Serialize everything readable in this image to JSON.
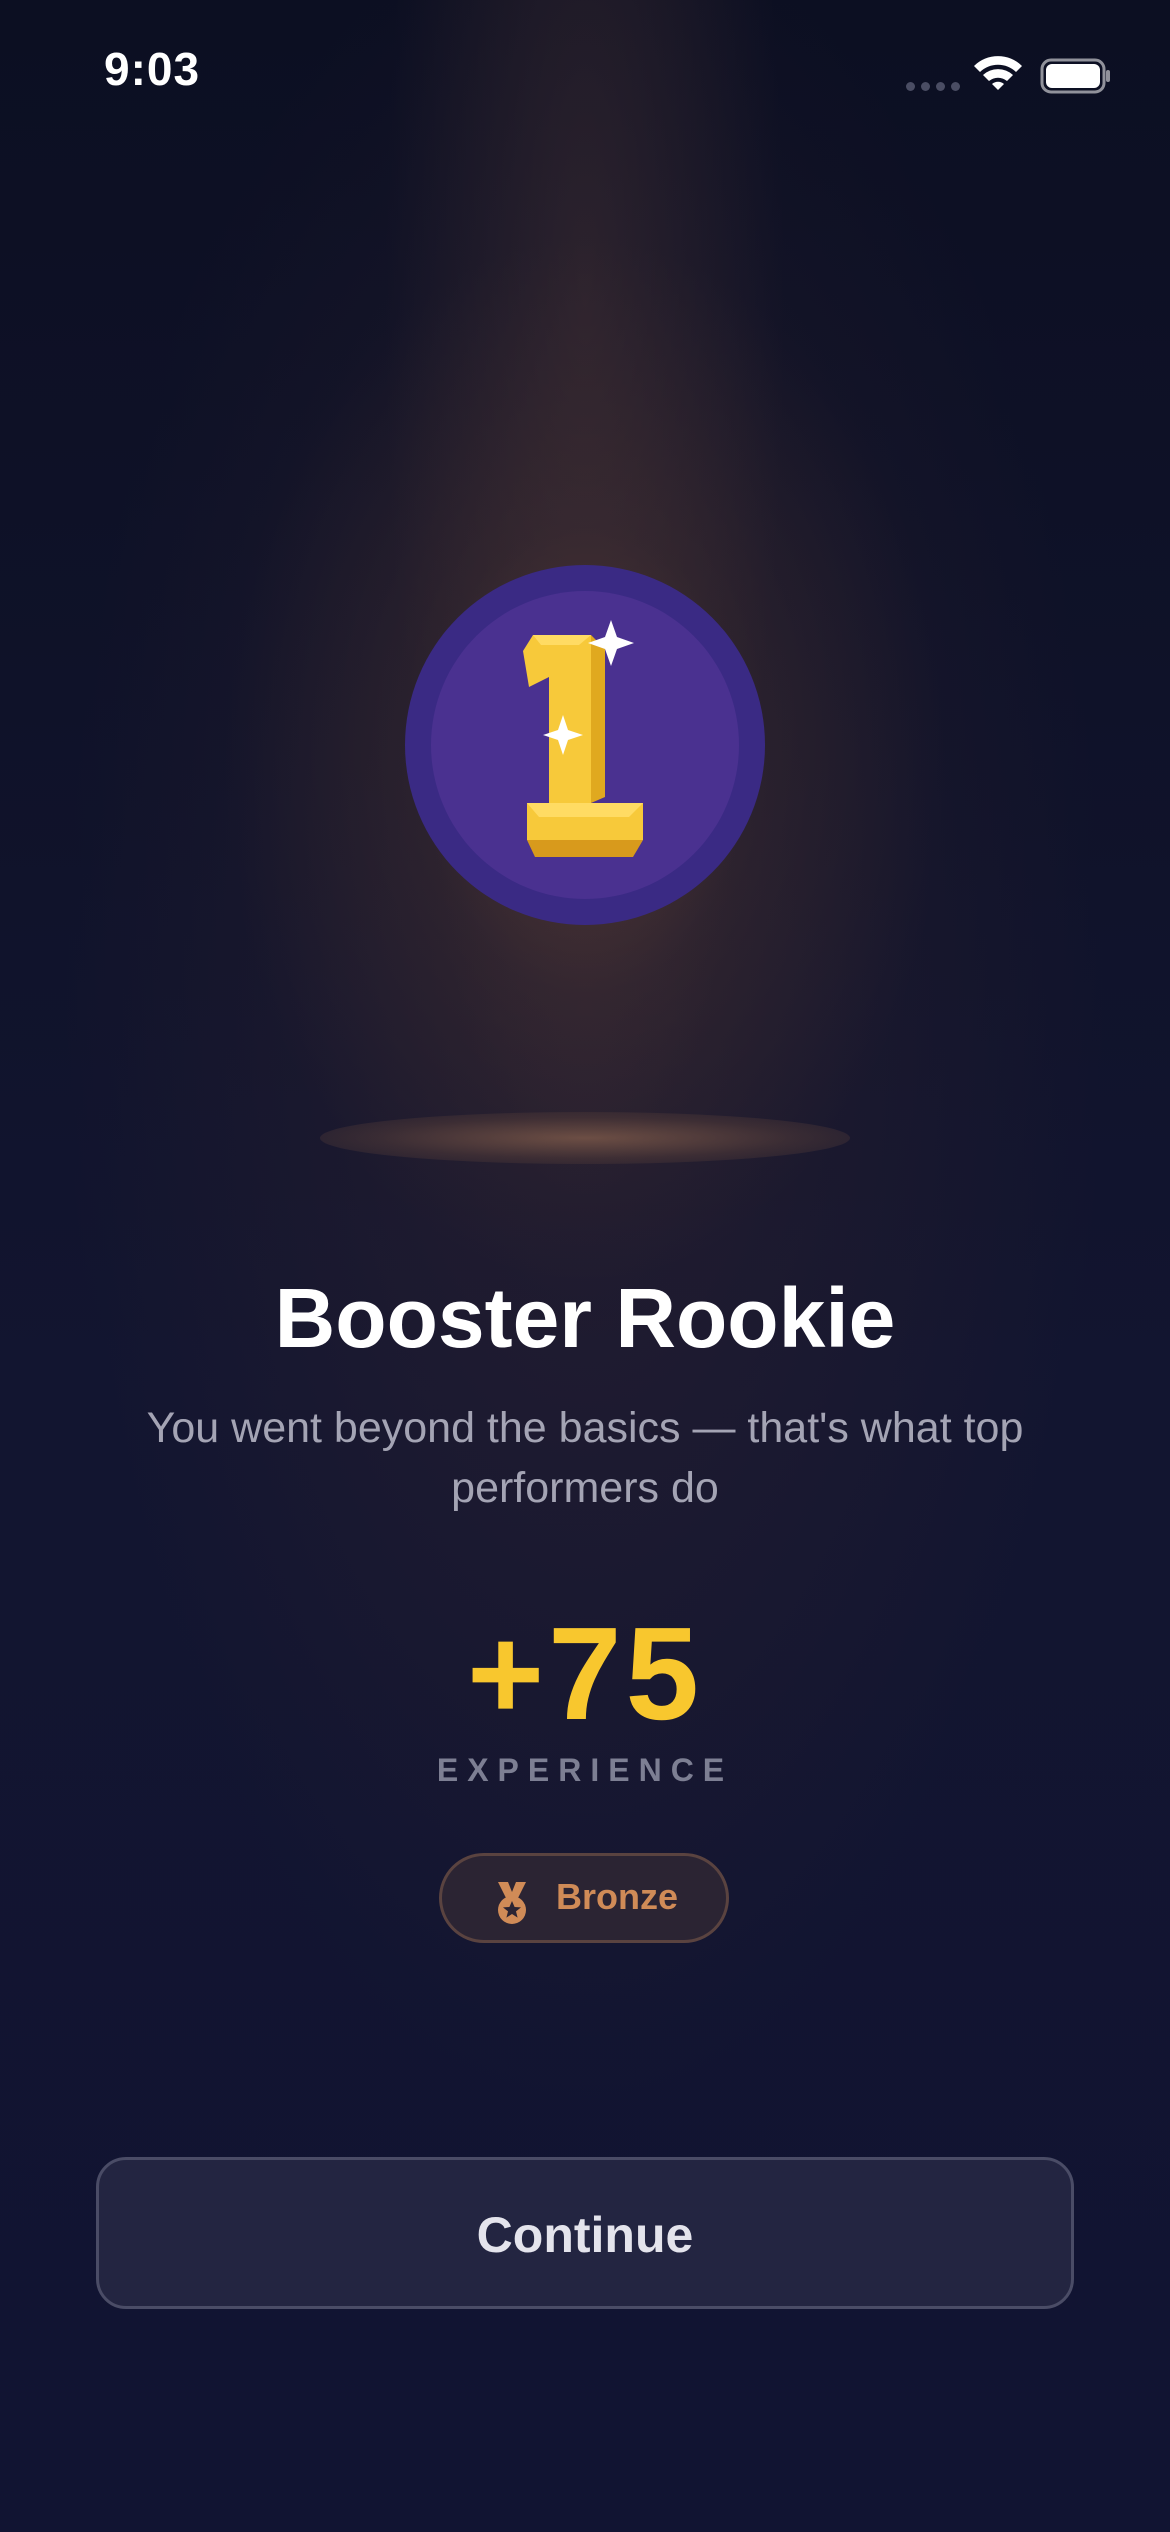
{
  "status_bar": {
    "time": "9:03",
    "icons": [
      "signal-icon",
      "wifi-icon",
      "battery-icon"
    ]
  },
  "achievement": {
    "badge_icon": "number-one-trophy-icon",
    "badge_number": "1",
    "title": "Booster Rookie",
    "subtitle": "You went beyond the basics — that's what top performers do"
  },
  "reward": {
    "amount": "+75",
    "label": "EXPERIENCE"
  },
  "tier": {
    "icon": "medal-icon",
    "label": "Bronze"
  },
  "actions": {
    "continue_label": "Continue"
  },
  "colors": {
    "background": "#0f1229",
    "badge": "#3a2a84",
    "xp_accent": "#f8c72e",
    "bronze": "#d08b57",
    "button": "#232541"
  }
}
